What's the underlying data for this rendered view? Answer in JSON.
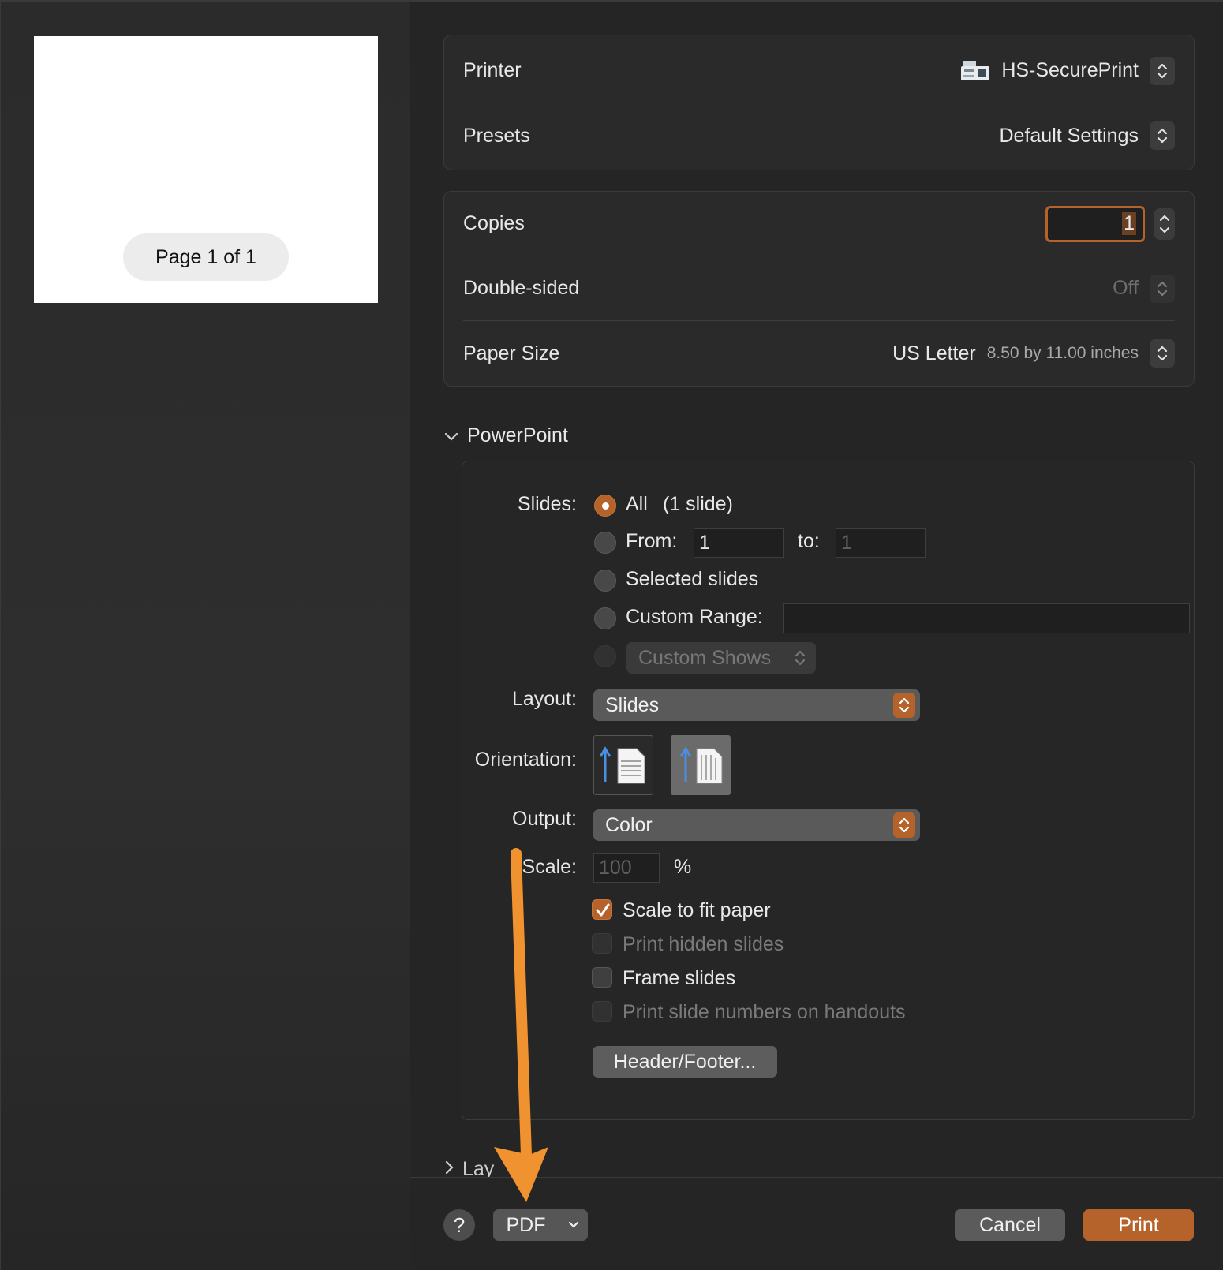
{
  "preview": {
    "page_label": "Page 1 of 1"
  },
  "printer_group": {
    "printer_label": "Printer",
    "printer_value": "HS-SecurePrint",
    "presets_label": "Presets",
    "presets_value": "Default Settings"
  },
  "copies_group": {
    "copies_label": "Copies",
    "copies_value": "1",
    "double_sided_label": "Double-sided",
    "double_sided_value": "Off",
    "paper_size_label": "Paper Size",
    "paper_size_value": "US Letter",
    "paper_size_sub": "8.50 by 11.00 inches"
  },
  "powerpoint": {
    "section_title": "PowerPoint",
    "slides_label": "Slides:",
    "all_label": "All",
    "all_count": "(1 slide)",
    "from_label": "From:",
    "from_value": "1",
    "to_label": "to:",
    "to_value": "1",
    "selected_label": "Selected slides",
    "custom_range_label": "Custom Range:",
    "custom_shows_label": "Custom Shows",
    "layout_label": "Layout:",
    "layout_value": "Slides",
    "orientation_label": "Orientation:",
    "output_label": "Output:",
    "output_value": "Color",
    "scale_label": "Scale:",
    "scale_value": "100",
    "scale_unit": "%",
    "scale_to_fit": "Scale to fit paper",
    "print_hidden": "Print hidden slides",
    "frame_slides": "Frame slides",
    "print_numbers": "Print slide numbers on handouts",
    "header_footer_button": "Header/Footer..."
  },
  "next_section_peek": "Lay",
  "bottom": {
    "help": "?",
    "pdf": "PDF",
    "cancel": "Cancel",
    "print": "Print"
  },
  "colors": {
    "accent": "#b5622b",
    "annotation_arrow": "#f0922f"
  }
}
